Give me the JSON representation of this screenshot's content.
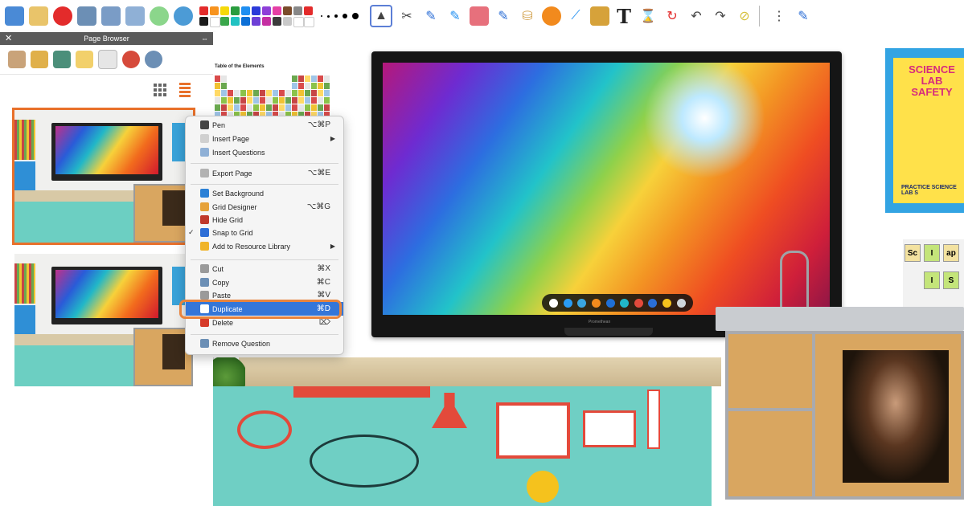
{
  "toolbar": {
    "tools": [
      "page-icon",
      "contacts-icon",
      "stop-icon",
      "screen-capture-icon",
      "print-icon",
      "export-icon",
      "play-icon",
      "globe-icon"
    ],
    "palette": [
      "#e32b2b",
      "#f7931e",
      "#f5d90a",
      "#2a9d3f",
      "#1f8ef1",
      "#2b3ad9",
      "#8e3fd8",
      "#e53fa5",
      "#7a4b2a",
      "#888888",
      "#e32b2b",
      "#1b1b1b",
      "#ffffff",
      "#3aa74b",
      "#21c2c2",
      "#0c6fd6",
      "#6d3fd6",
      "#c52fa2",
      "#3b3b3b",
      "#c9c9c9",
      "#ffffff",
      "#ffffff"
    ],
    "text_tool_glyph": "T"
  },
  "page_browser": {
    "title": "Page Browser",
    "close_glyph": "✕",
    "pin_glyph": "⇔",
    "tools": [
      "folder-icon",
      "media-icon",
      "house-icon",
      "note-icon",
      "page-icon",
      "spinner-icon",
      "recycle-icon"
    ]
  },
  "canvas": {
    "periodic_title": "Table of the Elements",
    "tv_brand": "Promethean",
    "poster_title": "SCIENCE LAB SAFETY",
    "poster_footer": "PRACTICE SCIENCE LAB S",
    "cards": [
      {
        "symbol": "Sc",
        "color": "#f3e2a0"
      },
      {
        "symbol": "I",
        "color": "#c4e57a"
      },
      {
        "symbol": "ap",
        "color": "#f3e2a0"
      },
      {
        "symbol": "I",
        "color": "#c4e57a"
      },
      {
        "symbol": "S",
        "color": "#c4e57a"
      }
    ]
  },
  "context_menu": {
    "items": [
      {
        "label": "Pen",
        "shortcut": "⌥⌘P",
        "icon": "pen-icon",
        "color": "#444444"
      },
      {
        "label": "Insert Page",
        "submenu": true,
        "icon": "insert-page-icon",
        "color": "#d0d0d0"
      },
      {
        "label": "Insert Questions",
        "icon": "insert-questions-icon",
        "color": "#8fb0d6"
      },
      {
        "label": "Export Page",
        "shortcut": "⌥⌘E",
        "icon": "export-page-icon",
        "color": "#b2b2b2"
      },
      {
        "label": "Set Background",
        "icon": "background-icon",
        "color": "#2a80d6"
      },
      {
        "label": "Grid Designer",
        "shortcut": "⌥⌘G",
        "icon": "grid-designer-icon",
        "color": "#e6a23a"
      },
      {
        "label": "Hide Grid",
        "icon": "hide-grid-icon",
        "color": "#c0392b"
      },
      {
        "label": "Snap to Grid",
        "checked": true,
        "icon": "snap-grid-icon",
        "color": "#2d6ed6"
      },
      {
        "label": "Add to Resource Library",
        "submenu": true,
        "icon": "resource-library-icon",
        "color": "#f0b429"
      },
      {
        "label": "Cut",
        "shortcut": "⌘X",
        "icon": "cut-icon",
        "color": "#9a9a9a"
      },
      {
        "label": "Copy",
        "shortcut": "⌘C",
        "icon": "copy-icon",
        "color": "#6c8fb5"
      },
      {
        "label": "Paste",
        "shortcut": "⌘V",
        "icon": "paste-icon",
        "color": "#9a9a9a"
      },
      {
        "label": "Duplicate",
        "shortcut": "⌘D",
        "highlighted": true,
        "icon": "duplicate-icon",
        "color": "#ffffff"
      },
      {
        "label": "Delete",
        "shortcut": "⌦",
        "icon": "delete-icon",
        "color": "#d63b2a"
      },
      {
        "label": "Remove Question",
        "icon": "remove-question-icon",
        "color": "#6c8fb5"
      }
    ]
  }
}
